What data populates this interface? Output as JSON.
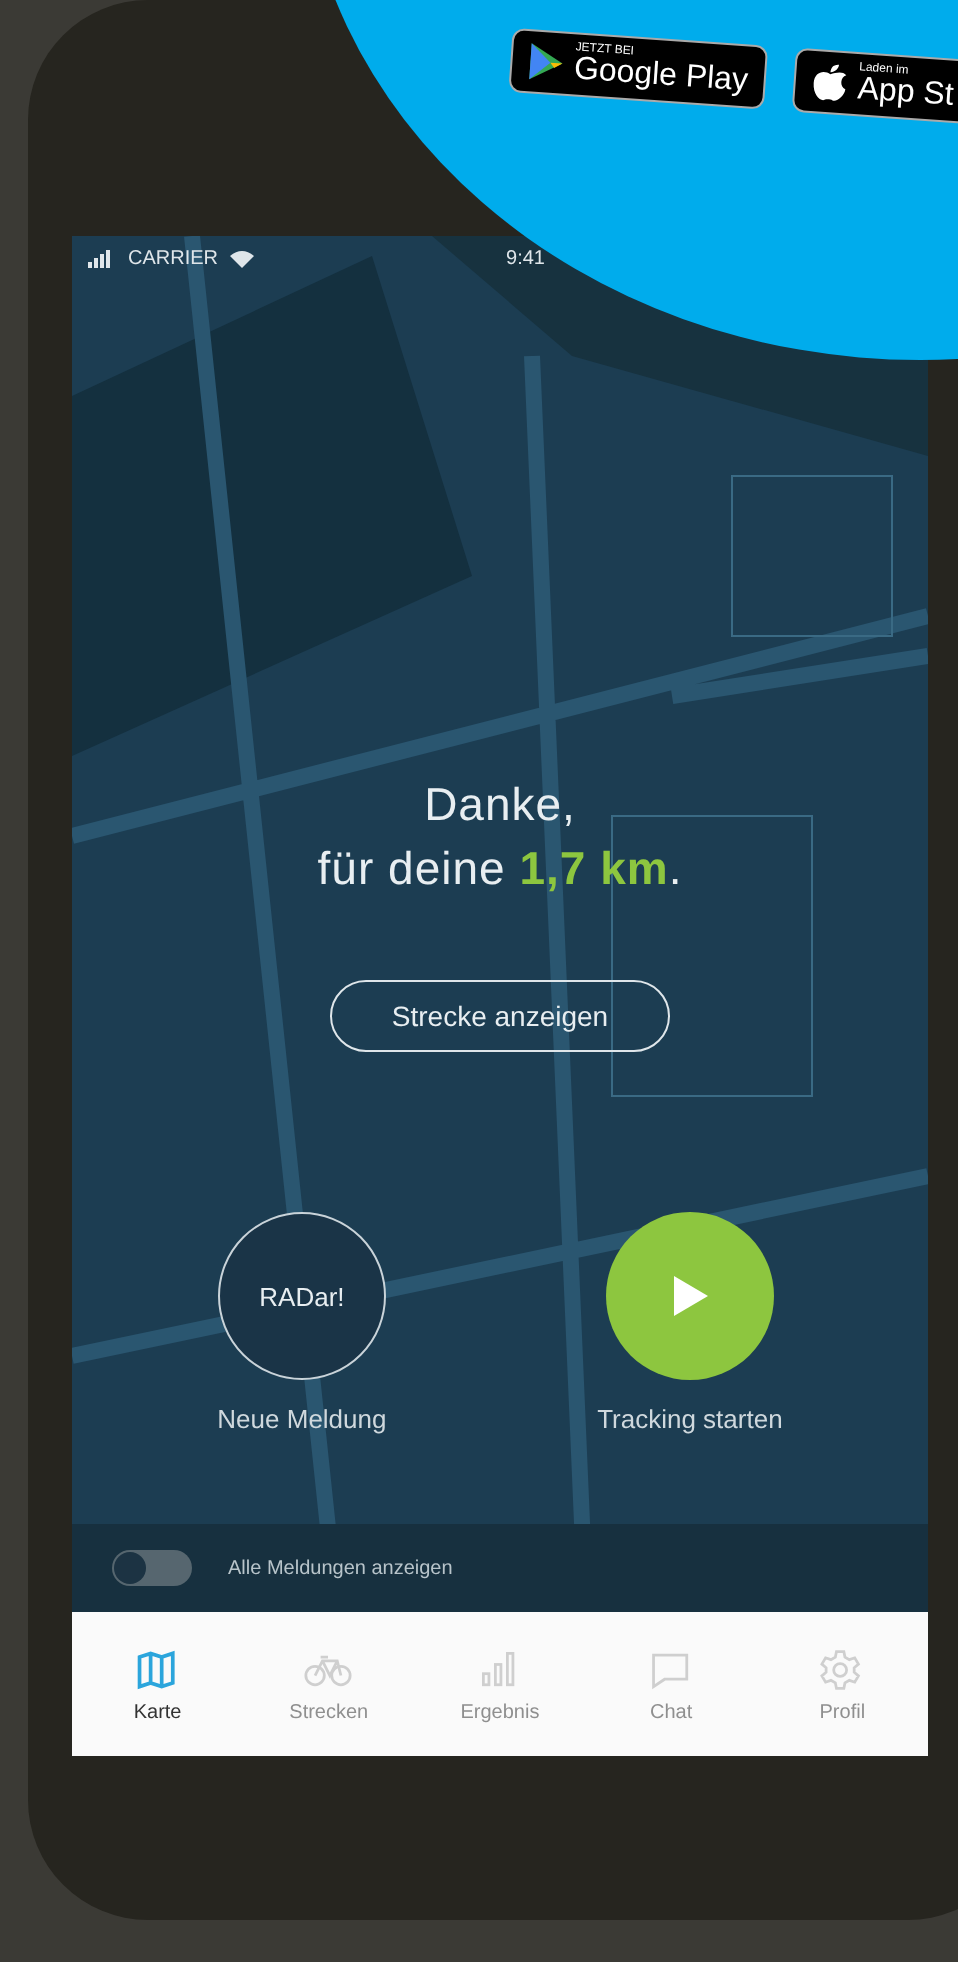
{
  "promo": {
    "badges": [
      {
        "kind": "google",
        "caption": "JETZT BEI",
        "store": "Google Play"
      },
      {
        "kind": "apple",
        "caption": "Laden im",
        "store": "App St"
      }
    ]
  },
  "status_bar": {
    "carrier": "CARRIER",
    "time": "9:41"
  },
  "message": {
    "line_1": "Danke,",
    "line_2_prefix": "für deine ",
    "distance": "1,7 km",
    "line_2_suffix": "."
  },
  "route_button": "Strecke anzeigen",
  "actions": [
    {
      "kind": "report",
      "icon_text": "RADar!",
      "label": "Neue Meldung"
    },
    {
      "kind": "track",
      "label": "Tracking starten"
    }
  ],
  "toggle": {
    "label": "Alle Meldungen anzeigen",
    "on": false
  },
  "tabs": [
    {
      "kind": "map",
      "label": "Karte",
      "selected": true
    },
    {
      "kind": "bike",
      "label": "Strecken",
      "selected": false
    },
    {
      "kind": "chart",
      "label": "Ergebnis",
      "selected": false
    },
    {
      "kind": "chat",
      "label": "Chat",
      "selected": false
    },
    {
      "kind": "gear",
      "label": "Profil",
      "selected": false
    }
  ]
}
